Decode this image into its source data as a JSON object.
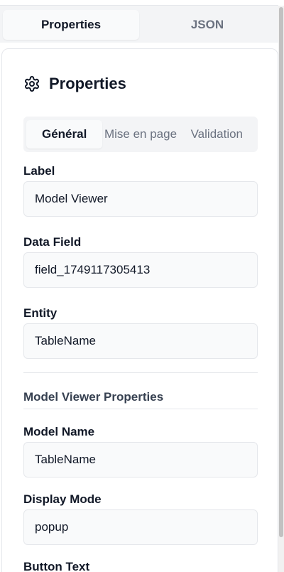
{
  "top_tabs": [
    {
      "label": "Properties",
      "active": true
    },
    {
      "label": "JSON",
      "active": false
    }
  ],
  "panel": {
    "icon": "gear-icon",
    "title": "Properties"
  },
  "sub_tabs": [
    {
      "label": "Général",
      "active": true
    },
    {
      "label": "Mise en page",
      "active": false
    },
    {
      "label": "Validation",
      "active": false
    }
  ],
  "fields": {
    "label": {
      "label": "Label",
      "value": "Model Viewer"
    },
    "data_field": {
      "label": "Data Field",
      "value": "field_1749117305413"
    },
    "entity": {
      "label": "Entity",
      "value": "TableName"
    }
  },
  "section": {
    "title": "Model Viewer Properties",
    "fields": {
      "model_name": {
        "label": "Model Name",
        "value": "TableName"
      },
      "display_mode": {
        "label": "Display Mode",
        "value": "popup"
      },
      "button_text": {
        "label": "Button Text"
      }
    }
  },
  "colors": {
    "active_tab_bg": "#f9fafb",
    "tab_bar_bg": "#f3f4f6",
    "input_bg": "#f9fafb",
    "border": "#e5e7eb",
    "muted_text": "#6b7280"
  }
}
